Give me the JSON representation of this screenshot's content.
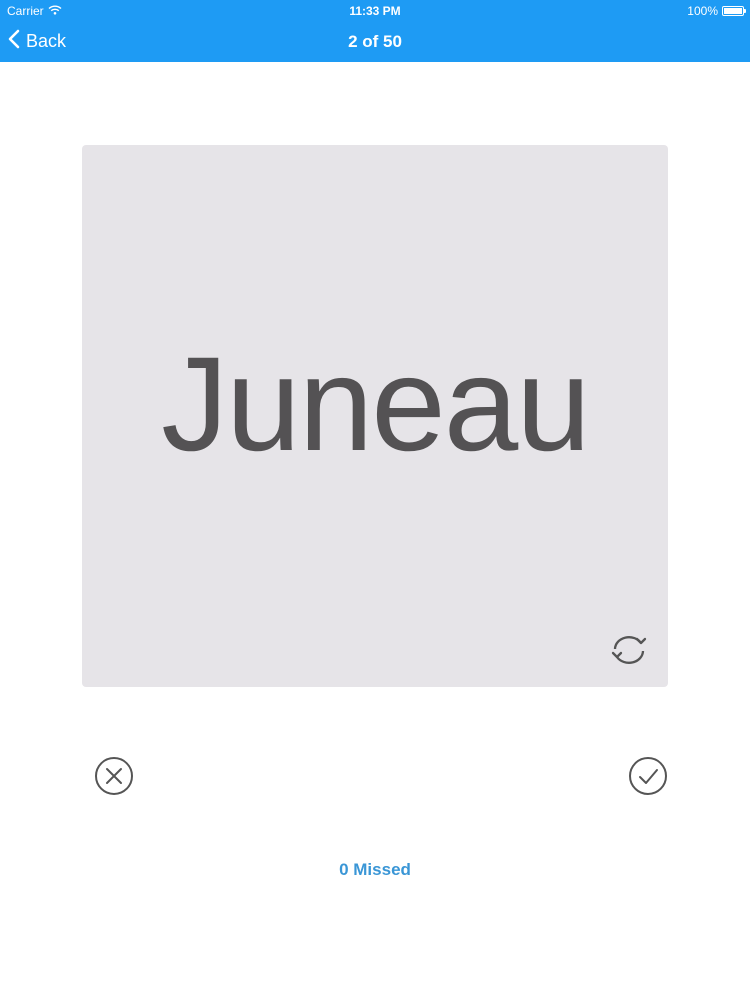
{
  "status_bar": {
    "carrier": "Carrier",
    "time": "11:33 PM",
    "battery": "100%"
  },
  "nav": {
    "back_label": "Back",
    "title": "2 of 50"
  },
  "card": {
    "word": "Juneau"
  },
  "footer": {
    "missed_label": "0 Missed"
  },
  "icons": {
    "back": "chevron-left-icon",
    "wifi": "wifi-icon",
    "battery": "battery-icon",
    "flip": "refresh-icon",
    "incorrect": "close-circle-icon",
    "correct": "check-circle-icon"
  },
  "colors": {
    "nav_background": "#1e9bf4",
    "card_background": "#e6e4e8",
    "word_text": "#545254",
    "missed_text": "#3a96d6",
    "icon_stroke": "#555555"
  }
}
